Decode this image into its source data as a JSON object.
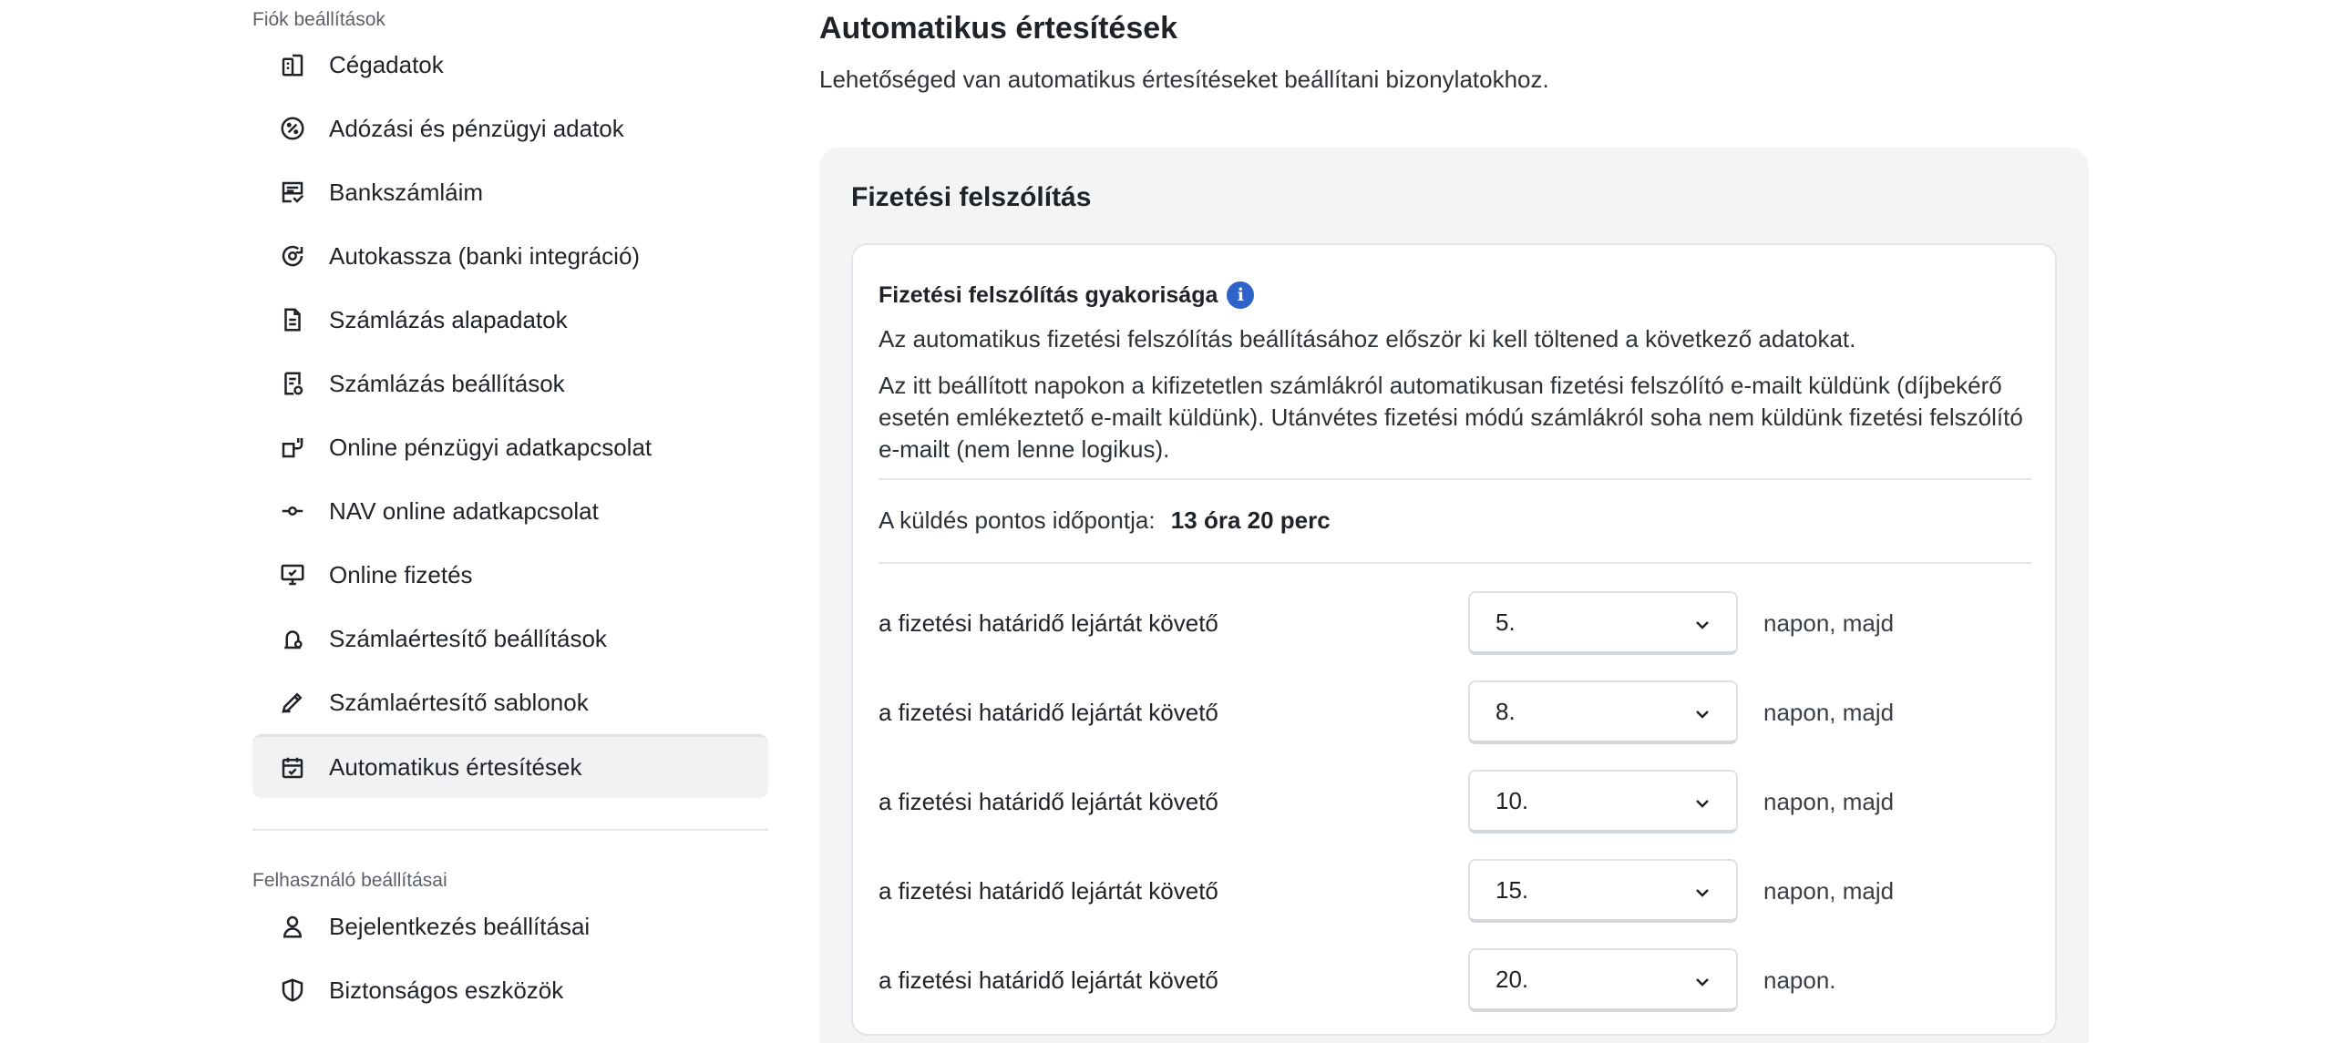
{
  "sidebar": {
    "account_section_title": "Fiók beállítások",
    "account_items": [
      {
        "label": "Cégadatok",
        "icon": "building-icon"
      },
      {
        "label": "Adózási és pénzügyi adatok",
        "icon": "percent-icon"
      },
      {
        "label": "Bankszámláim",
        "icon": "bank-note-icon"
      },
      {
        "label": "Autokassza (banki integráció)",
        "icon": "refresh-coin-icon"
      },
      {
        "label": "Számlázás alapadatok",
        "icon": "document-icon"
      },
      {
        "label": "Számlázás beállítások",
        "icon": "document-settings-icon"
      },
      {
        "label": "Online pénzügyi adatkapcsolat",
        "icon": "plug-icon"
      },
      {
        "label": "NAV online adatkapcsolat",
        "icon": "connection-icon"
      },
      {
        "label": "Online fizetés",
        "icon": "monitor-payment-icon"
      },
      {
        "label": "Számlaértesítő beállítások",
        "icon": "notify-settings-icon"
      },
      {
        "label": "Számlaértesítő sablonok",
        "icon": "template-pen-icon"
      },
      {
        "label": "Automatikus értesítések",
        "icon": "calendar-check-icon",
        "active": true
      }
    ],
    "user_section_title": "Felhasználó beállításai",
    "user_items": [
      {
        "label": "Bejelentkezés beállításai",
        "icon": "user-icon"
      },
      {
        "label": "Biztonságos eszközök",
        "icon": "shield-icon"
      }
    ]
  },
  "main": {
    "title": "Automatikus értesítések",
    "subtitle": "Lehetőséged van automatikus értesítéseket beállítani bizonylatokhoz.",
    "panel_title": "Fizetési felszólítás",
    "frequency_title": "Fizetési felszólítás gyakorisága",
    "info_glyph": "i",
    "description_1": "Az automatikus fizetési felszólítás beállításához először ki kell töltened a következő adatokat.",
    "description_2": "Az itt beállított napokon a kifizetetlen számlákról automatikusan fizetési felszólító e-mailt küldünk (díjbekérő esetén emlékeztető e-mailt küldünk). Utánvétes fizetési módú számlákról soha nem küldünk fizetési felszólító e-mailt (nem lenne logikus).",
    "send_time_label": "A küldés pontos időpontja:",
    "send_time_value": "13 óra 20 perc",
    "rules": [
      {
        "label": "a fizetési határidő lejártát követő",
        "value": "5.",
        "suffix": "napon, majd"
      },
      {
        "label": "a fizetési határidő lejártát követő",
        "value": "8.",
        "suffix": "napon, majd"
      },
      {
        "label": "a fizetési határidő lejártát követő",
        "value": "10.",
        "suffix": "napon, majd"
      },
      {
        "label": "a fizetési határidő lejártát követő",
        "value": "15.",
        "suffix": "napon, majd"
      },
      {
        "label": "a fizetési határidő lejártát követő",
        "value": "20.",
        "suffix": "napon."
      }
    ]
  }
}
